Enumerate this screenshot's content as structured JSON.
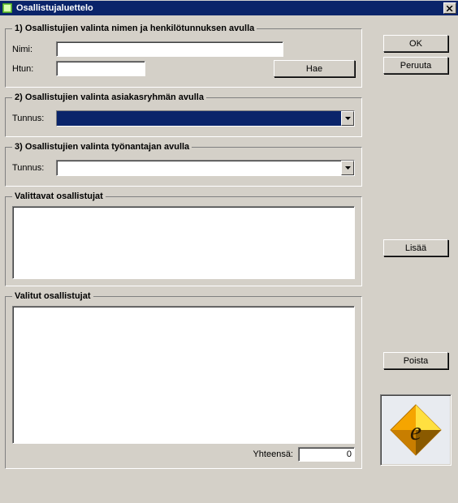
{
  "window": {
    "title": "Osallistujaluettelo"
  },
  "group1": {
    "legend": "1) Osallistujien valinta nimen ja henkilötunnuksen avulla",
    "name_label": "Nimi:",
    "name_value": "",
    "htun_label": "Htun:",
    "htun_value": "",
    "hae_label": "Hae"
  },
  "group2": {
    "legend": "2) Osallistujien valinta asiakasryhmän avulla",
    "tunnus_label": "Tunnus:",
    "tunnus_value": ""
  },
  "group3": {
    "legend": "3) Osallistujien valinta työnantajan avulla",
    "tunnus_label": "Tunnus:",
    "tunnus_value": ""
  },
  "selectable": {
    "legend": "Valittavat osallistujat"
  },
  "selected": {
    "legend": "Valitut osallistujat",
    "total_label": "Yhteensä:",
    "total_value": "0"
  },
  "buttons": {
    "ok": "OK",
    "cancel": "Peruuta",
    "add": "Lisää",
    "remove": "Poista"
  },
  "icons": {
    "app": "app-icon",
    "close": "close-icon",
    "dropdown": "chevron-down-icon",
    "logo_letter": "e"
  }
}
